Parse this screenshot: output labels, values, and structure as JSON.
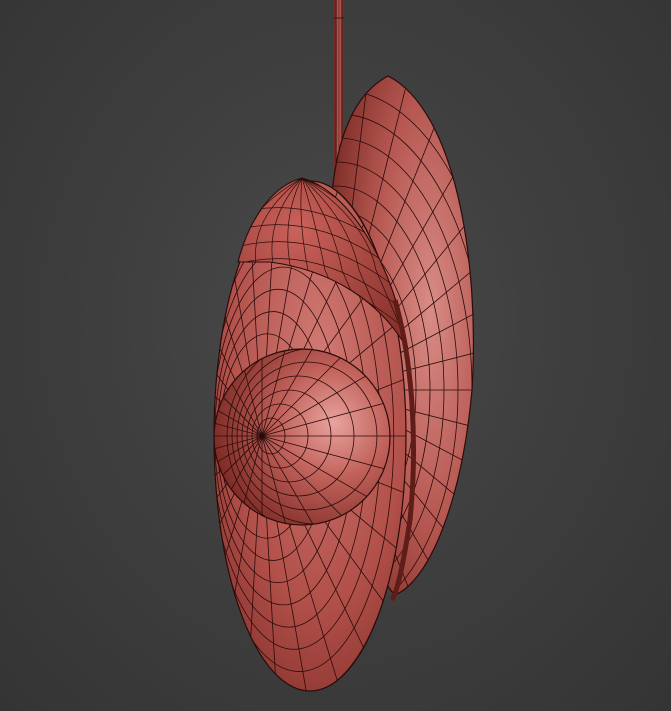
{
  "viewport": {
    "background": "#3c3c3c"
  },
  "model": {
    "parts": [
      "suspension-rod",
      "back-disc",
      "front-disc",
      "sphere"
    ],
    "material_color": "#b5504a",
    "wire_color": "#2a0c0a",
    "highlight_color": "#e59a94",
    "shadow_color": "#6d2420"
  }
}
